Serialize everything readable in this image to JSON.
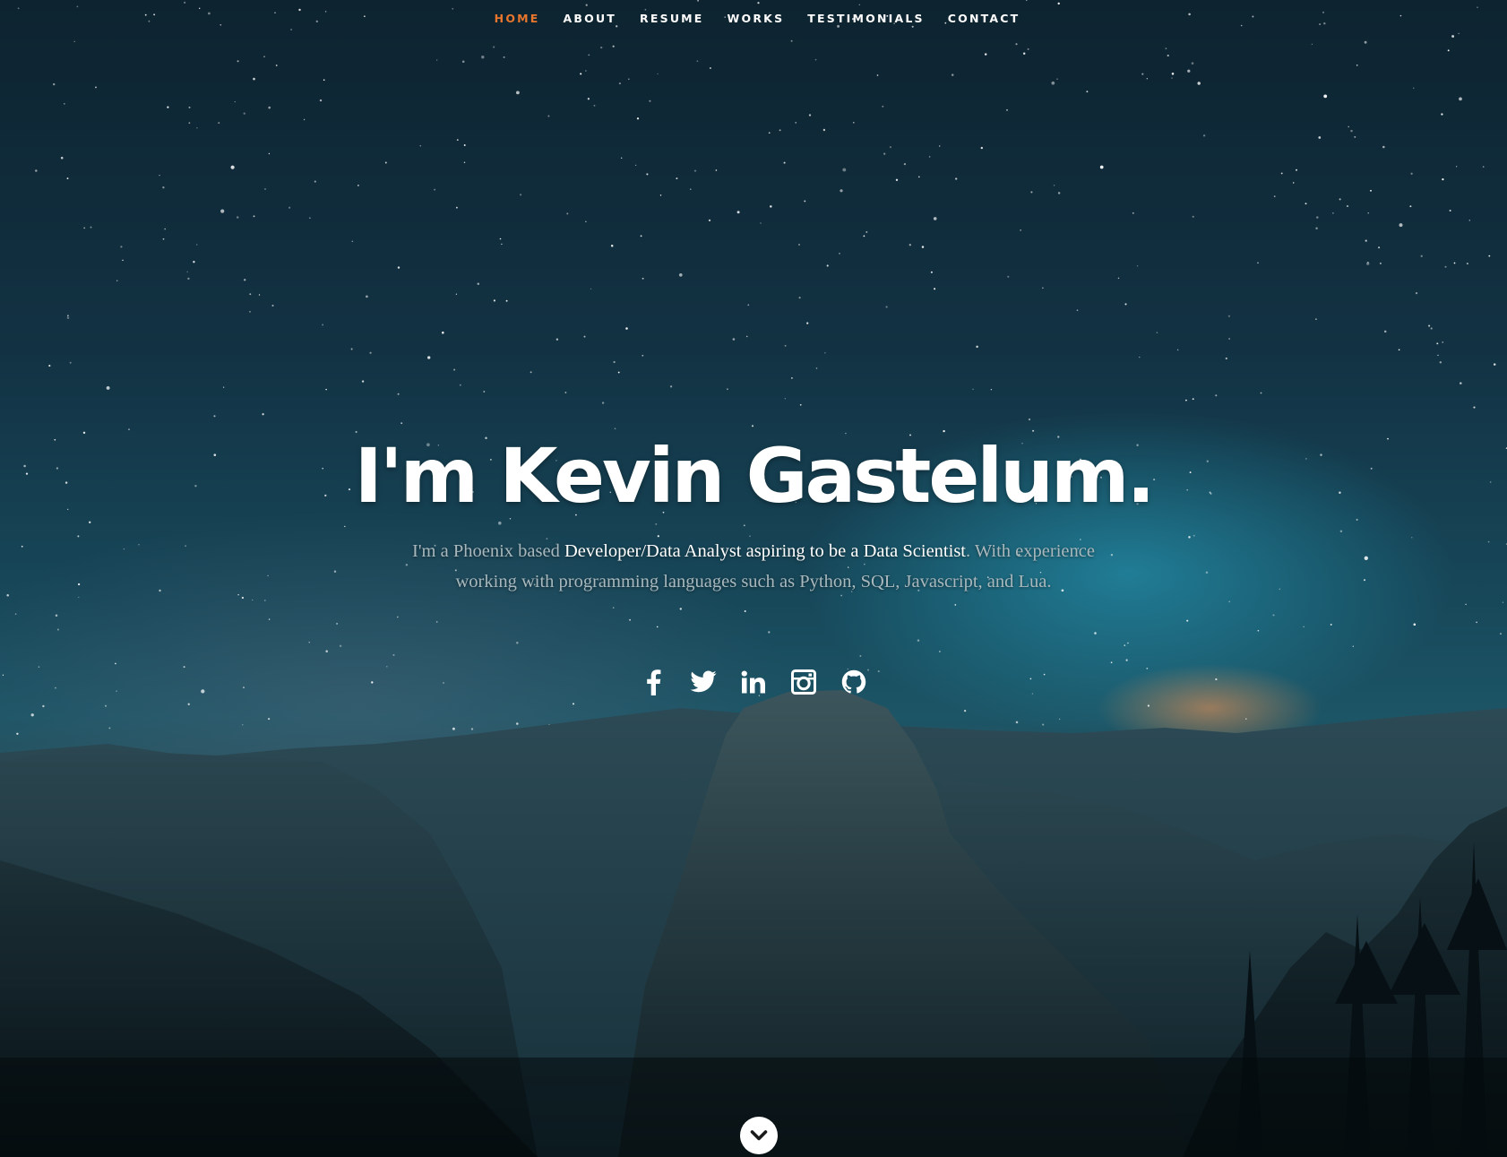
{
  "nav": {
    "items": [
      {
        "label": "HOME",
        "active": true
      },
      {
        "label": "ABOUT",
        "active": false
      },
      {
        "label": "RESUME",
        "active": false
      },
      {
        "label": "WORKS",
        "active": false
      },
      {
        "label": "TESTIMONIALS",
        "active": false
      },
      {
        "label": "CONTACT",
        "active": false
      }
    ],
    "active_color": "#e8762c"
  },
  "hero": {
    "headline": "I'm Kevin Gastelum.",
    "intro_prefix": "I'm a Phoenix based ",
    "intro_highlight": "Developer/Data Analyst aspiring to be a Data Scientist",
    "intro_suffix": ". With experience working with programming languages such as Python, SQL, Javascript, and Lua."
  },
  "social": [
    {
      "name": "facebook",
      "icon": "facebook-icon"
    },
    {
      "name": "twitter",
      "icon": "twitter-icon"
    },
    {
      "name": "linkedin",
      "icon": "linkedin-icon"
    },
    {
      "name": "instagram",
      "icon": "instagram-icon"
    },
    {
      "name": "github",
      "icon": "github-icon"
    }
  ],
  "scroll": {
    "icon": "chevron-down-icon"
  }
}
